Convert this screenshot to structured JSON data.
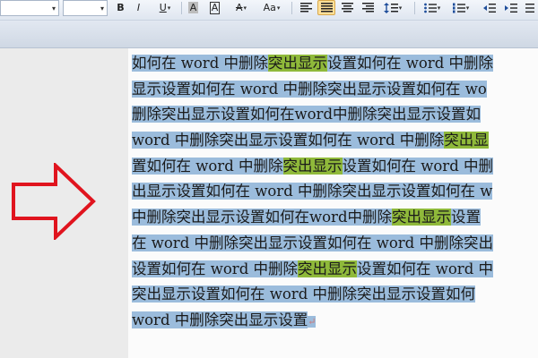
{
  "toolbar": {
    "bold": "B",
    "italic": "I",
    "underline": "U",
    "char_shading": "A",
    "char_border": "A",
    "clear_format": "A",
    "change_case": "Aa",
    "dropdown_arrow": "▾"
  },
  "document": {
    "lines": [
      [
        {
          "t": "如何在 word 中删除",
          "h": false
        },
        {
          "t": "突出显示",
          "h": true
        },
        {
          "t": "设置如何在 word 中删除",
          "h": false
        }
      ],
      [
        {
          "t": "显示设置如何在 word 中删除突出显示设置如何在 wo",
          "h": false
        }
      ],
      [
        {
          "t": "删除突出显示设置如何在word中删除突出显示设置如",
          "h": false
        }
      ],
      [
        {
          "t": "word 中删除突出显示设置如何在 word 中删除",
          "h": false
        },
        {
          "t": "突出显",
          "h": true
        }
      ],
      [
        {
          "t": "置如何在 word 中删除",
          "h": false
        },
        {
          "t": "突出显示",
          "h": true
        },
        {
          "t": "设置如何在 word 中删",
          "h": false
        }
      ],
      [
        {
          "t": "出显示设置如何在 word 中删除突出显示设置如何在 w",
          "h": false
        }
      ],
      [
        {
          "t": "中删除突出显示设置如何在word中删除",
          "h": false
        },
        {
          "t": "突出显示",
          "h": true
        },
        {
          "t": "设置",
          "h": false
        }
      ],
      [
        {
          "t": "在 word 中删除突出显示设置如何在 word 中删除突出",
          "h": false
        }
      ],
      [
        {
          "t": "设置如何在 word 中删除",
          "h": false
        },
        {
          "t": "突出显示",
          "h": true
        },
        {
          "t": "设置如何在 word 中",
          "h": false
        }
      ],
      [
        {
          "t": "突出显示设置如何在 word 中删除突出显示设置如何",
          "h": false
        }
      ],
      [
        {
          "t": "word 中删除突出显示设置",
          "h": false
        }
      ]
    ],
    "paragraph_mark": "↵"
  },
  "colors": {
    "selection": "#9bbcdc",
    "highlight": "#8fb93a",
    "arrow": "#e0141e"
  }
}
